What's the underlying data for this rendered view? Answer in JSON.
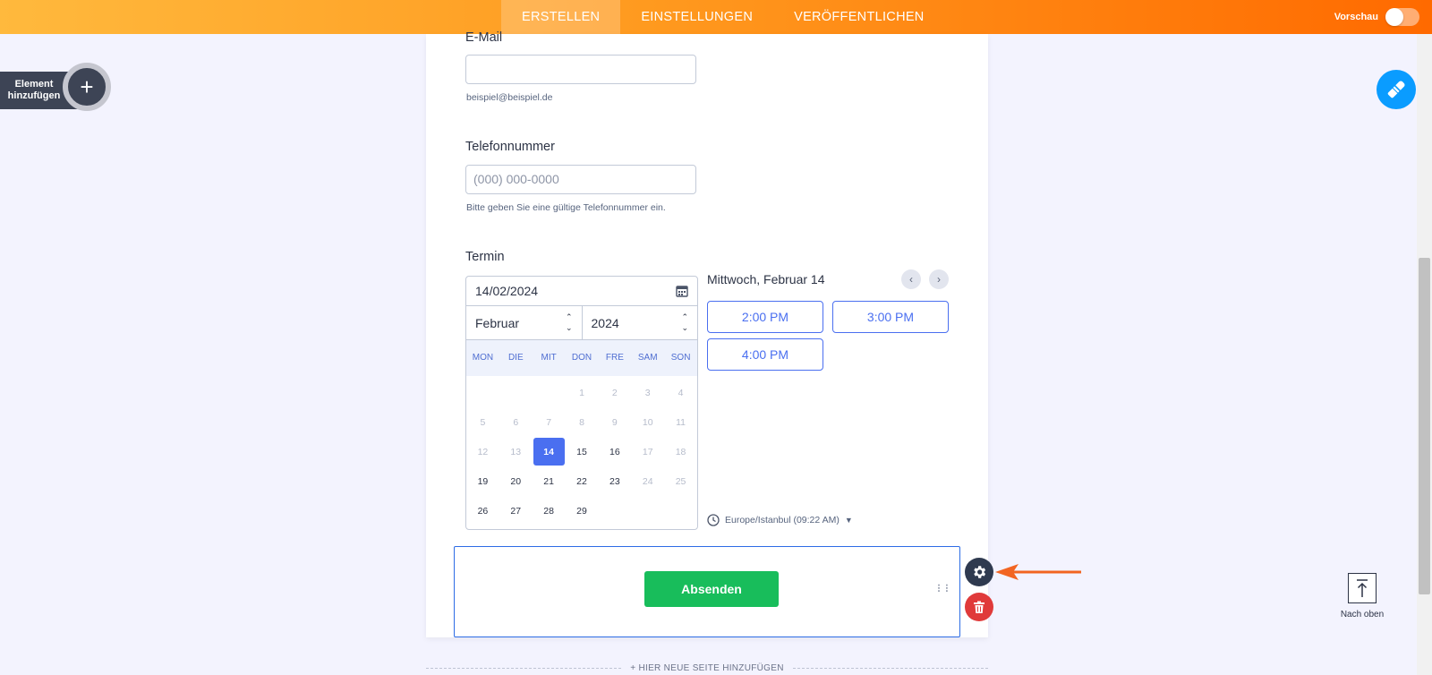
{
  "topbar": {
    "tabs": [
      {
        "label": "ERSTELLEN",
        "active": true
      },
      {
        "label": "EINSTELLUNGEN",
        "active": false
      },
      {
        "label": "VERÖFFENTLICHEN",
        "active": false
      }
    ],
    "preview_label": "Vorschau",
    "preview_enabled": false
  },
  "add_element": {
    "label": "Element hinzufügen",
    "icon": "plus-icon"
  },
  "form": {
    "email": {
      "label": "E-Mail",
      "value": "",
      "sublabel": "beispiel@beispiel.de"
    },
    "phone": {
      "label": "Telefonnummer",
      "placeholder": "(000) 000-0000",
      "sublabel": "Bitte geben Sie eine gültige Telefonnummer ein."
    },
    "appointment": {
      "label": "Termin",
      "date_value": "14/02/2024",
      "month": "Februar",
      "year": "2024",
      "weekdays": [
        "MON",
        "DIE",
        "MIT",
        "DON",
        "FRE",
        "SAM",
        "SON"
      ],
      "days": [
        "",
        "",
        "",
        "1",
        "2",
        "3",
        "4",
        "5",
        "6",
        "7",
        "8",
        "9",
        "10",
        "11",
        "12",
        "13",
        "14",
        "15",
        "16",
        "17",
        "18",
        "19",
        "20",
        "21",
        "22",
        "23",
        "24",
        "25",
        "26",
        "27",
        "28",
        "29",
        "",
        "",
        ""
      ],
      "available_days": [
        "14",
        "15",
        "16",
        "19",
        "20",
        "21",
        "22",
        "23",
        "26",
        "27",
        "28",
        "29"
      ],
      "selected_day": "14",
      "day_title": "Mittwoch, Februar 14",
      "slots": [
        "2:00 PM",
        "3:00 PM",
        "4:00 PM"
      ],
      "timezone": "Europe/Istanbul (09:22 AM)"
    },
    "submit_label": "Absenden",
    "new_page_label": "+ HIER NEUE SEITE HINZUFÜGEN"
  },
  "to_top_label": "Nach oben",
  "colors": {
    "accent": "#ff6a00",
    "primary": "#4a6ff0",
    "submit": "#18bd5b",
    "delete": "#e03a3a",
    "fab": "#0a9cff"
  }
}
